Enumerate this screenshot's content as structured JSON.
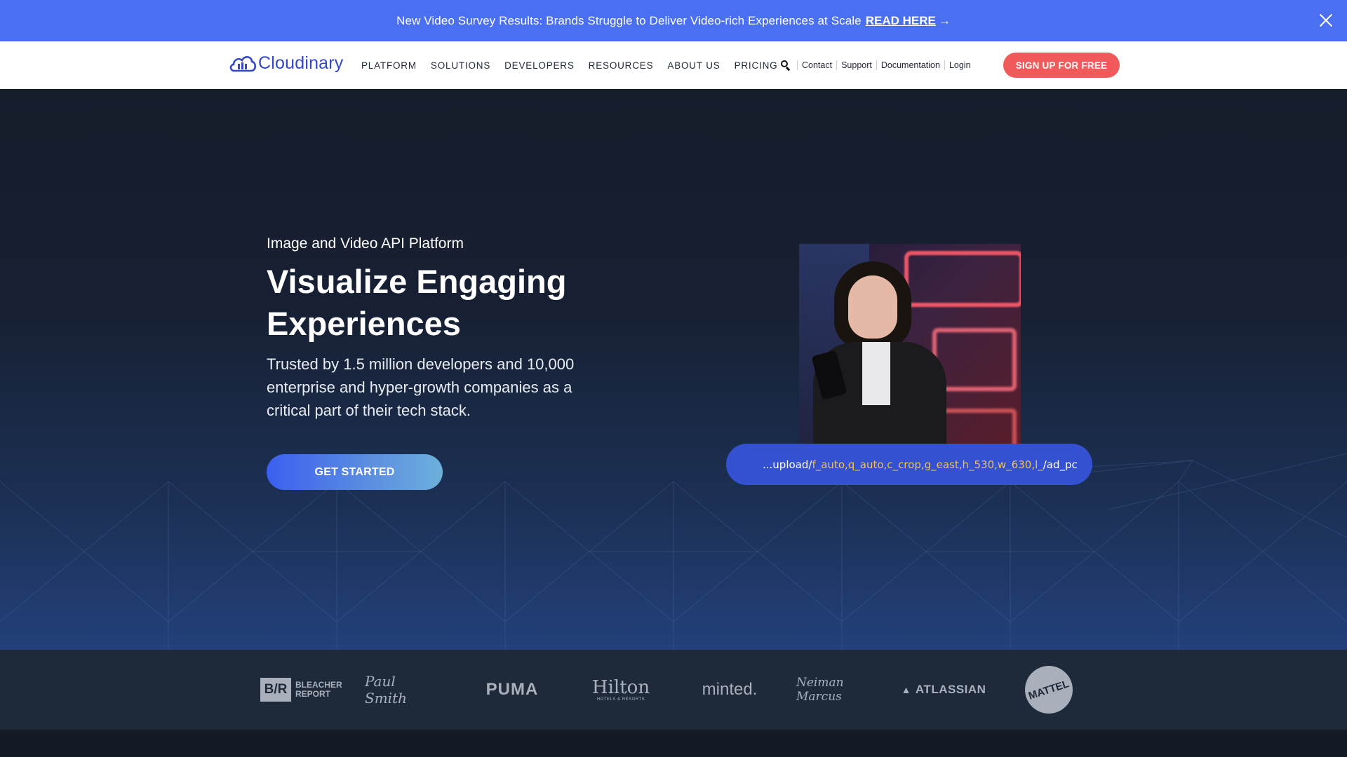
{
  "announcement": {
    "message": "New Video Survey Results: Brands Struggle to Deliver Video-rich Experiences at Scale",
    "link_label": "READ HERE",
    "arrow": "→"
  },
  "header": {
    "logo_text": "Cloudinary",
    "nav": [
      "PLATFORM",
      "SOLUTIONS",
      "DEVELOPERS",
      "RESOURCES",
      "ABOUT US",
      "PRICING"
    ],
    "utility": [
      "Contact",
      "Support",
      "Documentation",
      "Login"
    ],
    "signup_label": "SIGN UP FOR FREE"
  },
  "hero": {
    "eyebrow": "Image and Video API Platform",
    "headline": "Visualize Engaging Experiences",
    "subtext": "Trusted by 1.5 million developers and 10,000 enterprise and hyper-growth companies as a critical part of their tech stack.",
    "cta_label": "GET STARTED",
    "url_prefix": "...upload/",
    "url_params": "f_auto,q_auto,c_crop,g_east,h_530,w_630,l_",
    "url_suffix": "/ad_pc"
  },
  "logos": [
    "BLEACHER REPORT",
    "Paul Smith",
    "PUMA",
    "Hilton",
    "minted.",
    "Neiman Marcus",
    "ATLASSIAN",
    "MATTEL"
  ],
  "logo_sublabels": {
    "bleacher_mark": "B/R",
    "hilton_sub": "HOTELS & RESORTS"
  },
  "colors": {
    "announce": "#4a6ff0",
    "brand": "#3448c5",
    "signup": "#f15a5a",
    "url_highlight": "#f2c14e"
  }
}
